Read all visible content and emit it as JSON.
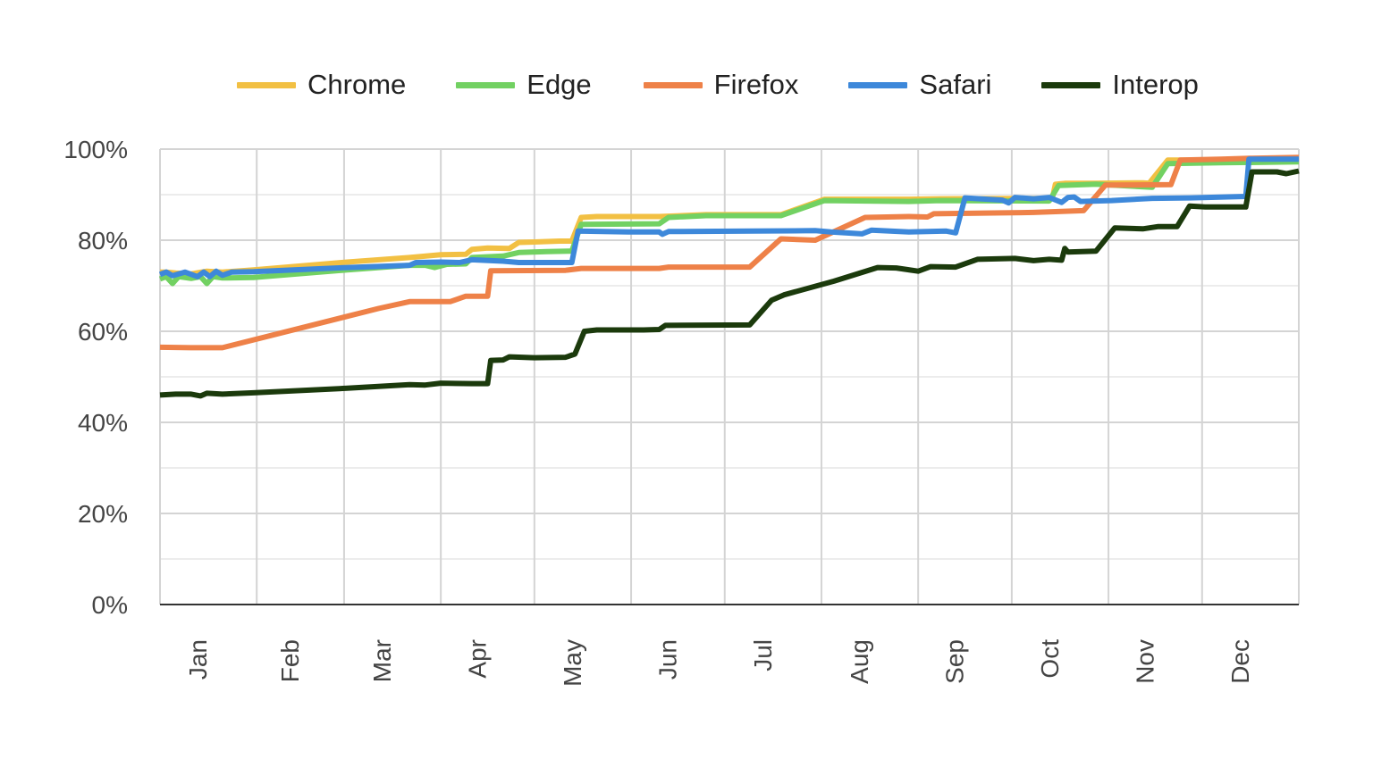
{
  "chart_data": {
    "type": "line",
    "title": "",
    "xlabel": "",
    "ylabel": "",
    "x_unit": "day of year",
    "xlim": [
      0,
      365
    ],
    "ylim": [
      0,
      100
    ],
    "y_ticks": [
      0,
      20,
      40,
      60,
      80,
      100
    ],
    "y_tick_labels": [
      "0%",
      "20%",
      "40%",
      "60%",
      "80%",
      "100%"
    ],
    "x_tick_labels": [
      "Jan",
      "Feb",
      "Mar",
      "Apr",
      "May",
      "Jun",
      "Jul",
      "Aug",
      "Sep",
      "Oct",
      "Nov",
      "Dec"
    ],
    "grid": true,
    "legend_position": "top",
    "series": [
      {
        "name": "Chrome",
        "color": "#F2C043",
        "points": [
          [
            0,
            73
          ],
          [
            2,
            73
          ],
          [
            5,
            72.8
          ],
          [
            10,
            72.6
          ],
          [
            15,
            73.2
          ],
          [
            20,
            73
          ],
          [
            30,
            73.5
          ],
          [
            60,
            75.2
          ],
          [
            80,
            76.2
          ],
          [
            90,
            76.8
          ],
          [
            98,
            76.9
          ],
          [
            100,
            78
          ],
          [
            105,
            78.3
          ],
          [
            112,
            78.2
          ],
          [
            115,
            79.5
          ],
          [
            120,
            79.6
          ],
          [
            128,
            79.8
          ],
          [
            132,
            79.8
          ],
          [
            135,
            85
          ],
          [
            140,
            85.2
          ],
          [
            160,
            85.2
          ],
          [
            175,
            85.6
          ],
          [
            190,
            85.6
          ],
          [
            199,
            85.6
          ],
          [
            213,
            89
          ],
          [
            240,
            89
          ],
          [
            250,
            89.1
          ],
          [
            286,
            89.2
          ],
          [
            287,
            92.3
          ],
          [
            290,
            92.5
          ],
          [
            300,
            92.5
          ],
          [
            315,
            92.6
          ],
          [
            317,
            92.5
          ],
          [
            323,
            97.6
          ],
          [
            330,
            97.6
          ],
          [
            340,
            97.4
          ],
          [
            350,
            97.6
          ],
          [
            365,
            97.8
          ]
        ]
      },
      {
        "name": "Edge",
        "color": "#72D162",
        "points": [
          [
            0,
            71.5
          ],
          [
            2,
            72
          ],
          [
            4,
            70.5
          ],
          [
            6,
            72
          ],
          [
            10,
            71.6
          ],
          [
            13,
            72
          ],
          [
            15,
            70.5
          ],
          [
            17,
            72
          ],
          [
            20,
            71.7
          ],
          [
            30,
            71.8
          ],
          [
            60,
            73.5
          ],
          [
            80,
            74.5
          ],
          [
            85,
            74.5
          ],
          [
            88,
            74
          ],
          [
            92,
            74.7
          ],
          [
            98,
            74.8
          ],
          [
            100,
            76.2
          ],
          [
            110,
            76.5
          ],
          [
            115,
            77.3
          ],
          [
            124,
            77.5
          ],
          [
            132,
            77.6
          ],
          [
            135,
            83.5
          ],
          [
            160,
            83.6
          ],
          [
            163,
            85
          ],
          [
            175,
            85.4
          ],
          [
            199,
            85.4
          ],
          [
            213,
            88.7
          ],
          [
            240,
            88.5
          ],
          [
            250,
            88.7
          ],
          [
            285,
            88.6
          ],
          [
            288,
            92
          ],
          [
            300,
            92.3
          ],
          [
            318,
            91.6
          ],
          [
            323,
            96.8
          ],
          [
            340,
            97
          ],
          [
            365,
            97.2
          ]
        ]
      },
      {
        "name": "Firefox",
        "color": "#EE8148",
        "points": [
          [
            0,
            56.5
          ],
          [
            10,
            56.4
          ],
          [
            20,
            56.4
          ],
          [
            70,
            65
          ],
          [
            80,
            66.5
          ],
          [
            93,
            66.5
          ],
          [
            98,
            67.7
          ],
          [
            105,
            67.7
          ],
          [
            106,
            73.3
          ],
          [
            130,
            73.4
          ],
          [
            135,
            73.8
          ],
          [
            160,
            73.8
          ],
          [
            163,
            74.1
          ],
          [
            189,
            74.1
          ],
          [
            199,
            80.3
          ],
          [
            210,
            80
          ],
          [
            226,
            85
          ],
          [
            240,
            85.2
          ],
          [
            246,
            85.1
          ],
          [
            248,
            85.8
          ],
          [
            270,
            86
          ],
          [
            280,
            86.1
          ],
          [
            296,
            86.5
          ],
          [
            303,
            92.1
          ],
          [
            324,
            92.2
          ],
          [
            327,
            97.6
          ],
          [
            340,
            97.8
          ],
          [
            350,
            98
          ],
          [
            365,
            98.2
          ]
        ]
      },
      {
        "name": "Safari",
        "color": "#3D88DA",
        "points": [
          [
            0,
            72.5
          ],
          [
            2,
            73
          ],
          [
            4,
            72.2
          ],
          [
            8,
            73
          ],
          [
            12,
            72
          ],
          [
            14,
            73
          ],
          [
            16,
            72
          ],
          [
            18,
            73.2
          ],
          [
            20,
            72.3
          ],
          [
            23,
            73
          ],
          [
            30,
            73.1
          ],
          [
            60,
            74
          ],
          [
            80,
            74.5
          ],
          [
            82,
            75.1
          ],
          [
            90,
            75.2
          ],
          [
            96,
            75.1
          ],
          [
            100,
            75.7
          ],
          [
            110,
            75.4
          ],
          [
            115,
            75.1
          ],
          [
            132,
            75.1
          ],
          [
            134,
            82
          ],
          [
            150,
            81.8
          ],
          [
            160,
            81.8
          ],
          [
            161,
            81.3
          ],
          [
            163,
            81.9
          ],
          [
            190,
            82
          ],
          [
            210,
            82.1
          ],
          [
            215,
            81.8
          ],
          [
            225,
            81.4
          ],
          [
            228,
            82.2
          ],
          [
            240,
            81.8
          ],
          [
            252,
            82
          ],
          [
            255,
            81.6
          ],
          [
            258,
            89.3
          ],
          [
            270,
            88.8
          ],
          [
            272,
            88.2
          ],
          [
            274,
            89.4
          ],
          [
            280,
            89.1
          ],
          [
            285,
            89.4
          ],
          [
            289,
            88.3
          ],
          [
            291,
            89.4
          ],
          [
            293,
            89.5
          ],
          [
            295,
            88.5
          ],
          [
            300,
            88.6
          ],
          [
            305,
            88.7
          ],
          [
            318,
            89.2
          ],
          [
            330,
            89.3
          ],
          [
            348,
            89.6
          ],
          [
            349,
            97.8
          ],
          [
            360,
            97.8
          ],
          [
            365,
            97.8
          ]
        ]
      },
      {
        "name": "Interop",
        "color": "#1B3A0C",
        "points": [
          [
            0,
            46
          ],
          [
            5,
            46.2
          ],
          [
            10,
            46.2
          ],
          [
            13,
            45.8
          ],
          [
            15,
            46.4
          ],
          [
            20,
            46.2
          ],
          [
            30,
            46.5
          ],
          [
            60,
            47.5
          ],
          [
            80,
            48.3
          ],
          [
            85,
            48.2
          ],
          [
            90,
            48.6
          ],
          [
            100,
            48.5
          ],
          [
            105,
            48.5
          ],
          [
            106,
            53.6
          ],
          [
            110,
            53.7
          ],
          [
            112,
            54.4
          ],
          [
            120,
            54.2
          ],
          [
            130,
            54.3
          ],
          [
            133,
            55
          ],
          [
            136,
            60
          ],
          [
            140,
            60.3
          ],
          [
            155,
            60.3
          ],
          [
            160,
            60.4
          ],
          [
            162,
            61.3
          ],
          [
            189,
            61.4
          ],
          [
            196,
            66.8
          ],
          [
            200,
            68
          ],
          [
            216,
            71
          ],
          [
            230,
            74
          ],
          [
            236,
            73.9
          ],
          [
            243,
            73.2
          ],
          [
            247,
            74.2
          ],
          [
            255,
            74.1
          ],
          [
            262,
            75.8
          ],
          [
            274,
            76
          ],
          [
            280,
            75.5
          ],
          [
            285,
            75.8
          ],
          [
            289,
            75.6
          ],
          [
            290,
            78.2
          ],
          [
            291,
            77.4
          ],
          [
            300,
            77.6
          ],
          [
            306,
            82.7
          ],
          [
            315,
            82.5
          ],
          [
            320,
            83
          ],
          [
            326,
            83
          ],
          [
            330,
            87.5
          ],
          [
            335,
            87.3
          ],
          [
            348,
            87.3
          ],
          [
            350,
            95
          ],
          [
            358,
            95
          ],
          [
            361,
            94.6
          ],
          [
            365,
            95.2
          ]
        ]
      }
    ]
  },
  "legend": {
    "items": [
      {
        "label": "Chrome",
        "color": "#F2C043"
      },
      {
        "label": "Edge",
        "color": "#72D162"
      },
      {
        "label": "Firefox",
        "color": "#EE8148"
      },
      {
        "label": "Safari",
        "color": "#3D88DA"
      },
      {
        "label": "Interop",
        "color": "#1B3A0C"
      }
    ]
  }
}
